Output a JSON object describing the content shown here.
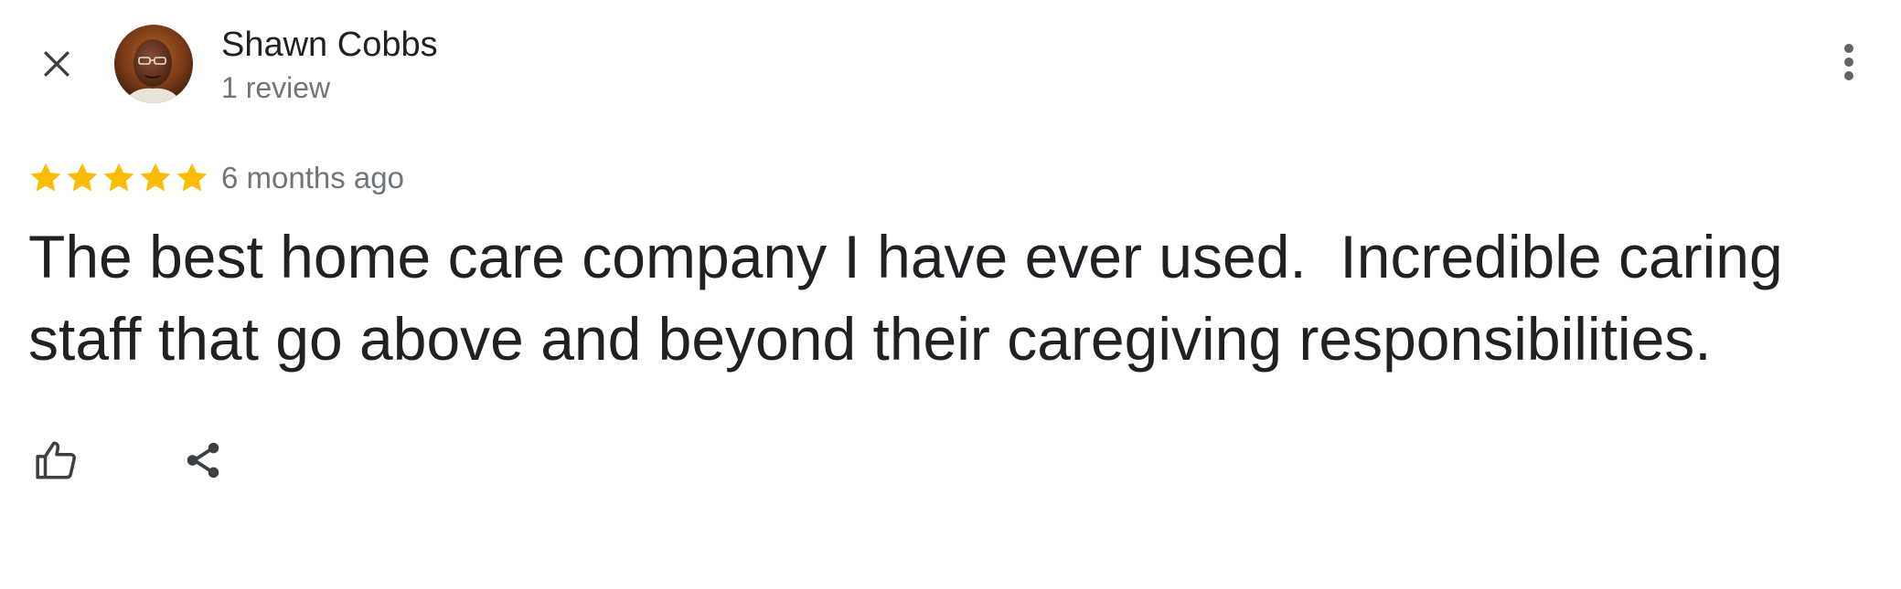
{
  "header": {
    "close_icon": "close-icon",
    "reviewer_name": "Shawn Cobbs",
    "review_count": "1 review",
    "more_icon": "more-vert-icon"
  },
  "review": {
    "rating": 5,
    "max_rating": 5,
    "time_ago": "6 months ago",
    "text": "The best home care company I have ever used.  Incredible caring staff that go above and beyond their caregiving responsibilities."
  },
  "actions": {
    "like_icon": "thumb-up-icon",
    "share_icon": "share-icon"
  },
  "colors": {
    "star": "#fbbc04",
    "primary_text": "#202124",
    "secondary_text": "#70757a",
    "icon": "#3c4043"
  }
}
